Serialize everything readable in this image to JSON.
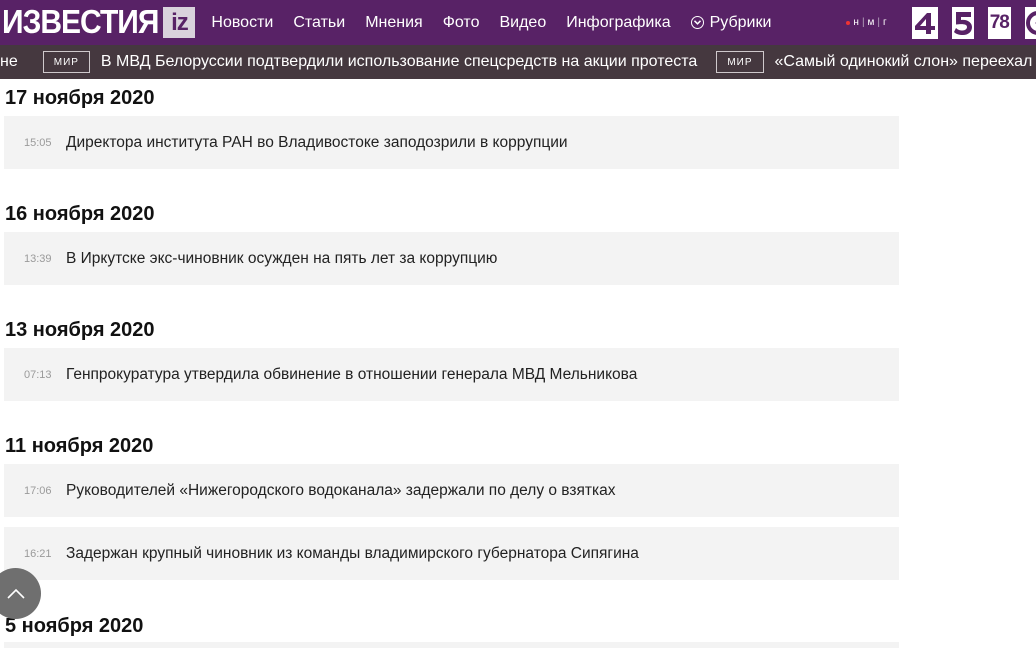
{
  "header": {
    "logo_text": "ИЗВЕСТИЯ",
    "logo_badge": "iz",
    "nav": [
      "Новости",
      "Статьи",
      "Мнения",
      "Фото",
      "Видео",
      "Инфографика",
      "Рубрики"
    ],
    "nmg": [
      "н",
      "м",
      "г"
    ],
    "channels": [
      "channel-4-logo",
      "channel-5-logo",
      "78",
      "channel-star-logo"
    ]
  },
  "ticker": {
    "lead": "не",
    "items": [
      {
        "tag": "МИР",
        "text": "В МВД Белоруссии подтвердили использование спецсредств на акции протеста"
      },
      {
        "tag": "МИР",
        "text": "«Самый одинокий слон» переехал"
      }
    ]
  },
  "feed": {
    "days": [
      {
        "date": "17 ноября 2020",
        "items": [
          {
            "time": "15:05",
            "title": "Директора института РАН во Владивостоке заподозрили в коррупции"
          }
        ]
      },
      {
        "date": "16 ноября 2020",
        "items": [
          {
            "time": "13:39",
            "title": "В Иркутске экс-чиновник осужден на пять лет за коррупцию"
          }
        ]
      },
      {
        "date": "13 ноября 2020",
        "items": [
          {
            "time": "07:13",
            "title": "Генпрокуратура утвердила обвинение в отношении генерала МВД Мельникова"
          }
        ]
      },
      {
        "date": "11 ноября 2020",
        "items": [
          {
            "time": "17:06",
            "title": "Руководителей «Нижегородского водоканала» задержали по делу о взятках"
          },
          {
            "time": "16:21",
            "title": "Задержан крупный чиновник из команды владимирского губернатора Сипягина"
          }
        ]
      },
      {
        "date": "5 ноября 2020",
        "items": []
      }
    ]
  },
  "colors": {
    "brand": "#582266",
    "ticker_bg": "#45383f",
    "card_bg": "#f3f3f3"
  }
}
